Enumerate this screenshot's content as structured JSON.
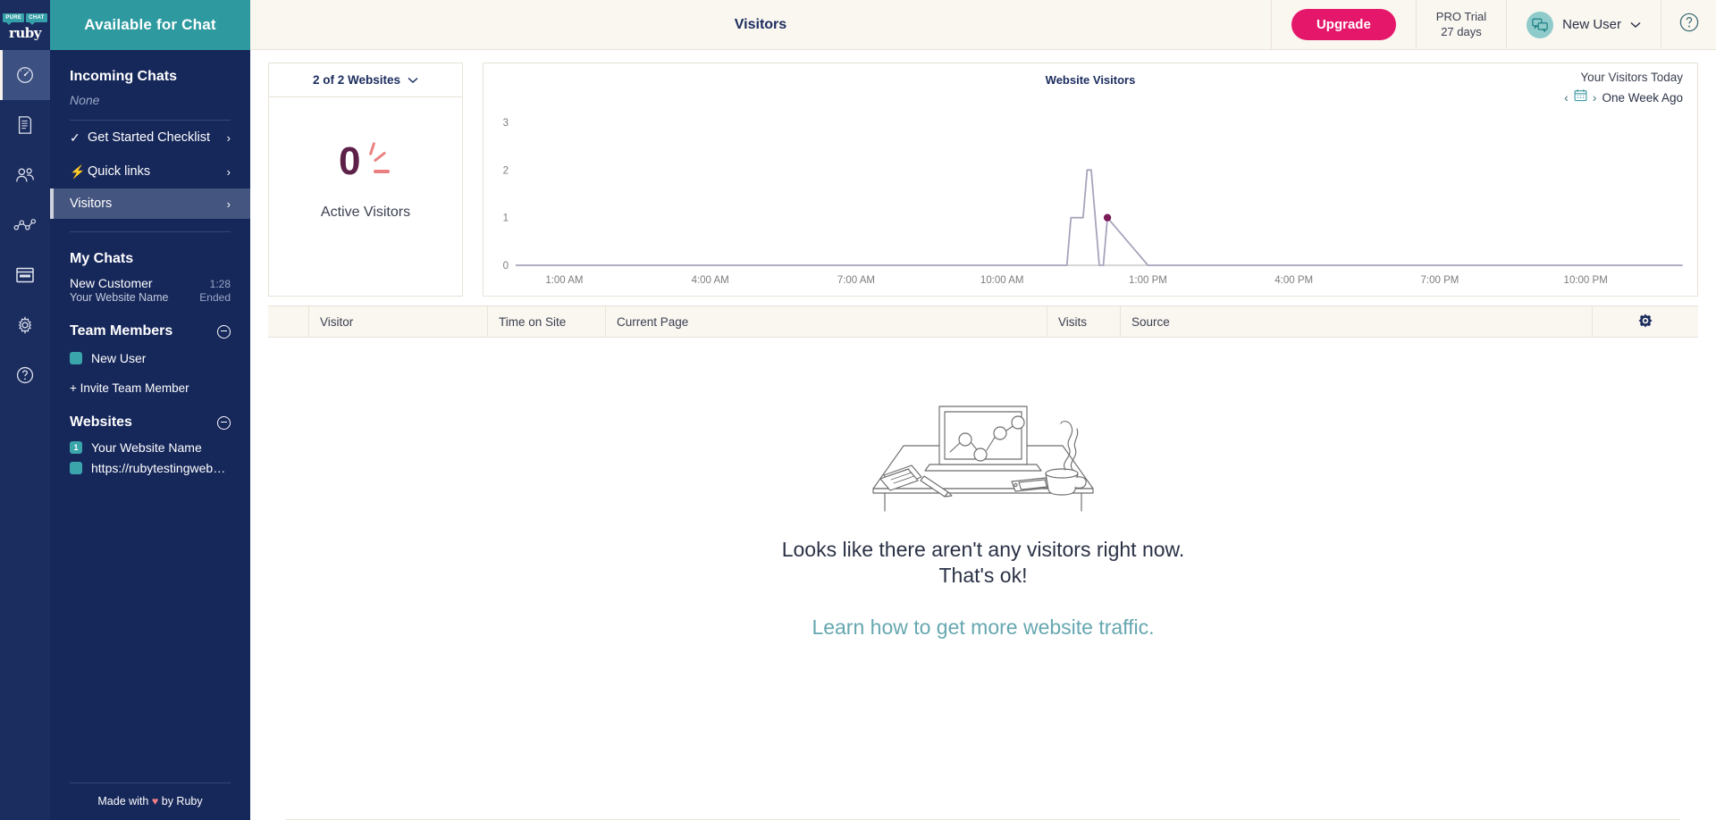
{
  "brand": {
    "logo_badge_1": "PURE",
    "logo_badge_2": "CHAT",
    "logo_word": "ruby",
    "accent_teal": "#2e9aa0",
    "accent_pink": "#e5176a",
    "navy": "#16275a",
    "cream": "#faf6f0"
  },
  "icon_rail": {
    "items": [
      {
        "name": "dashboard-icon",
        "label": "Dashboard",
        "active": true
      },
      {
        "name": "documents-icon",
        "label": "Documents",
        "active": false
      },
      {
        "name": "contacts-icon",
        "label": "Contacts",
        "active": false
      },
      {
        "name": "analytics-icon",
        "label": "Analytics",
        "active": false
      },
      {
        "name": "widget-icon",
        "label": "Widget",
        "active": false
      },
      {
        "name": "settings-gear-icon",
        "label": "Settings",
        "active": false
      },
      {
        "name": "help-circle-icon",
        "label": "Help",
        "active": false
      }
    ]
  },
  "sidebar": {
    "availability_label": "Available for Chat",
    "incoming_chats_title": "Incoming Chats",
    "incoming_chats_value": "None",
    "nav_items": [
      {
        "icon": "check-icon",
        "label": "Get Started Checklist",
        "chevron": "›"
      },
      {
        "icon": "bolt-icon",
        "label": "Quick links",
        "chevron": "›"
      },
      {
        "icon": "",
        "label": "Visitors",
        "chevron": "›",
        "selected": true
      }
    ],
    "my_chats_title": "My Chats",
    "chats": [
      {
        "name": "New Customer",
        "meta": "1:28"
      },
      {
        "name": "Your Website Name",
        "meta": "Ended"
      }
    ],
    "team_members_title": "Team Members",
    "team_members": [
      {
        "label": "New User",
        "swatch": "#3aa6ac",
        "badge": ""
      }
    ],
    "invite_label": "+ Invite Team Member",
    "websites_title": "Websites",
    "websites": [
      {
        "label": "Your Website Name",
        "swatch": "#3aa6ac",
        "badge": "1"
      },
      {
        "label": "https://rubytestingwebsi...",
        "swatch": "#3aa6ac",
        "badge": ""
      }
    ],
    "footer_prefix": "Made with ",
    "footer_heart": "♥",
    "footer_suffix": " by Ruby"
  },
  "topbar": {
    "title": "Visitors",
    "upgrade_label": "Upgrade",
    "trial_line1": "PRO Trial",
    "trial_line2": "27 days",
    "user_name": "New User",
    "user_caret": "⌄",
    "help_glyph": "?"
  },
  "active_visitors": {
    "websites_selector": "2 of 2 Websites",
    "chevron": "⌄",
    "count": "0",
    "label": "Active Visitors"
  },
  "chart_header": {
    "title": "Website Visitors",
    "your_visitors_today": "Your Visitors Today",
    "prev_arrow": "‹",
    "next_arrow": "›",
    "date_label": "One Week Ago",
    "calendar_icon": "calendar-icon"
  },
  "chart_data": {
    "type": "line",
    "title": "Website Visitors",
    "xlabel": "",
    "ylabel": "",
    "ylim": [
      0,
      3
    ],
    "yticks": [
      "0",
      "1",
      "2",
      "3"
    ],
    "xticks": [
      "1:00 AM",
      "4:00 AM",
      "7:00 AM",
      "10:00 AM",
      "1:00 PM",
      "4:00 PM",
      "7:00 PM",
      "10:00 PM"
    ],
    "grid": false,
    "legend": "none",
    "line_color": "#a9a3bc",
    "marker_color": "#7b1b57",
    "series": [
      {
        "name": "Visitors",
        "x": [
          "0:00",
          "1:00",
          "2:00",
          "3:00",
          "4:00",
          "5:00",
          "6:00",
          "7:00",
          "8:00",
          "9:00",
          "10:00",
          "11:00",
          "11:20",
          "11:25",
          "11:40",
          "11:45",
          "11:50",
          "11:55",
          "12:00",
          "12:05",
          "12:10",
          "13:00",
          "14:00",
          "16:00",
          "19:00",
          "22:00",
          "23:59"
        ],
        "values": [
          0,
          0,
          0,
          0,
          0,
          0,
          0,
          0,
          0,
          0,
          0,
          0,
          0,
          1,
          1,
          2,
          2,
          1,
          0,
          0,
          1,
          0,
          0,
          0,
          0,
          0,
          0
        ]
      }
    ],
    "current_point": {
      "x": "12:10",
      "y": 1
    }
  },
  "table": {
    "columns": [
      "",
      "Visitor",
      "Time on Site",
      "Current Page",
      "Visits",
      "Source",
      ""
    ],
    "headers": {
      "visitor": "Visitor",
      "time_on_site": "Time on Site",
      "current_page": "Current Page",
      "visits": "Visits",
      "source": "Source"
    },
    "settings_icon": "settings-gear-icon",
    "rows": []
  },
  "empty_state": {
    "illustration": "desk-with-laptop-illustration",
    "line1": "Looks like there aren't any visitors right now.",
    "line2": "That's ok!",
    "link": "Learn how to get more website traffic."
  }
}
